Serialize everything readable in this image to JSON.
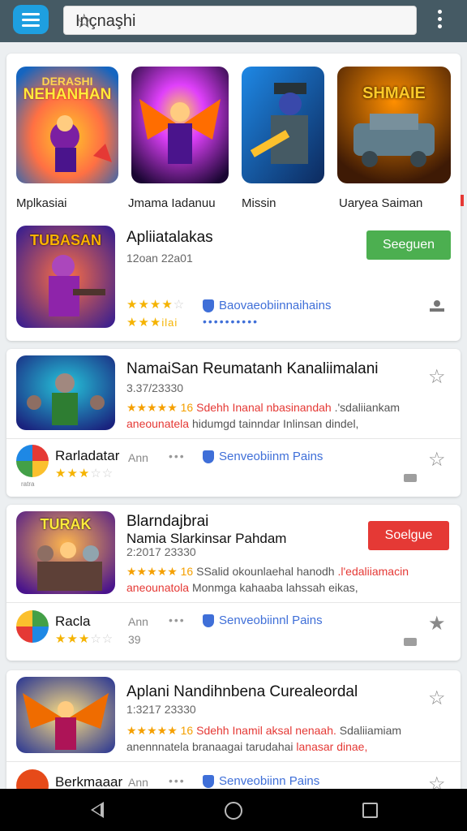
{
  "search": {
    "value": "Inçnaşhi"
  },
  "featured": [
    {
      "label": "Mplkasiai",
      "art": "NEHANHAN",
      "art_top": "DERASHI",
      "bg": "#1565c0"
    },
    {
      "label": "Jmama Iadanuu",
      "art": "",
      "bg": "#2a0d4a"
    },
    {
      "label": "Missin",
      "art": "",
      "bg": "#0d47a1"
    },
    {
      "label": "Uaryea Saiman",
      "art": "SHMAIE",
      "bg": "#5d2a0a"
    }
  ],
  "app1": {
    "title": "Apliiatalakas",
    "subtitle": "12oan 22a01",
    "install_label": "Seeguen",
    "art": "TUBASAN",
    "verified": "Baovaeobiinnaihains",
    "rating_text": "",
    "small_text": "ilai"
  },
  "app2": {
    "title": "NamaiSan Reumatanh Kanaliimalani",
    "subtitle": "3.37/23330",
    "desc_line1_rating": "★★★★★ 16",
    "desc_line1_red": "Sdehh Inanal nbasinandah",
    "desc_line1_grey": ".'sdaliiankam",
    "desc_line2_orange": "aneounatela",
    "desc_line2_grey": "hidumgd tainndar Inlinsan dindel,"
  },
  "sub2": {
    "name": "Rarladatar",
    "ann": "Ann",
    "verified": "Senveobiinm Pains",
    "small": "ratra"
  },
  "app3": {
    "title": "Blarndajbrai",
    "title2": "Namia Slarkinsar Pahdam",
    "subtitle": "2:2017 23330",
    "install_label": "Soelgue",
    "art": "TURAK",
    "desc_line1_rating": "★★★★★ 16",
    "desc_line1_grey": "SSalid okounlaehal hanodh",
    "desc_line1_red": ".l'edaliiamacin",
    "desc_line2_orange": "aneounatola",
    "desc_line2_grey": "Monmga kahaaba lahssah eikas,"
  },
  "sub3": {
    "name": "Racla",
    "ann": "Ann",
    "num": "39",
    "verified": "Senveobiinnl Pains"
  },
  "app4": {
    "title": "Aplani Nandihnbena Curealeordal",
    "subtitle": "1:3217 23330",
    "desc_line1_rating": "★★★★★ 16",
    "desc_line1_red": "Sdehh Inamil aksal nenaah.",
    "desc_line1_grey": "Sdaliiamiam",
    "desc_line2_grey": "anennnatela branaagai tarudahai",
    "desc_line2_orange": "lanasar dinae,"
  },
  "sub4": {
    "name": "Berkmaaar",
    "ann": "Ann",
    "verified": "Senveobiinn Pains"
  },
  "colors": {
    "topbar": "#455a64",
    "accent": "#1e9fe0",
    "install_green": "#4caf50",
    "install_red": "#e53935",
    "verified_blue": "#3f6fd8",
    "star": "#f5b301"
  }
}
